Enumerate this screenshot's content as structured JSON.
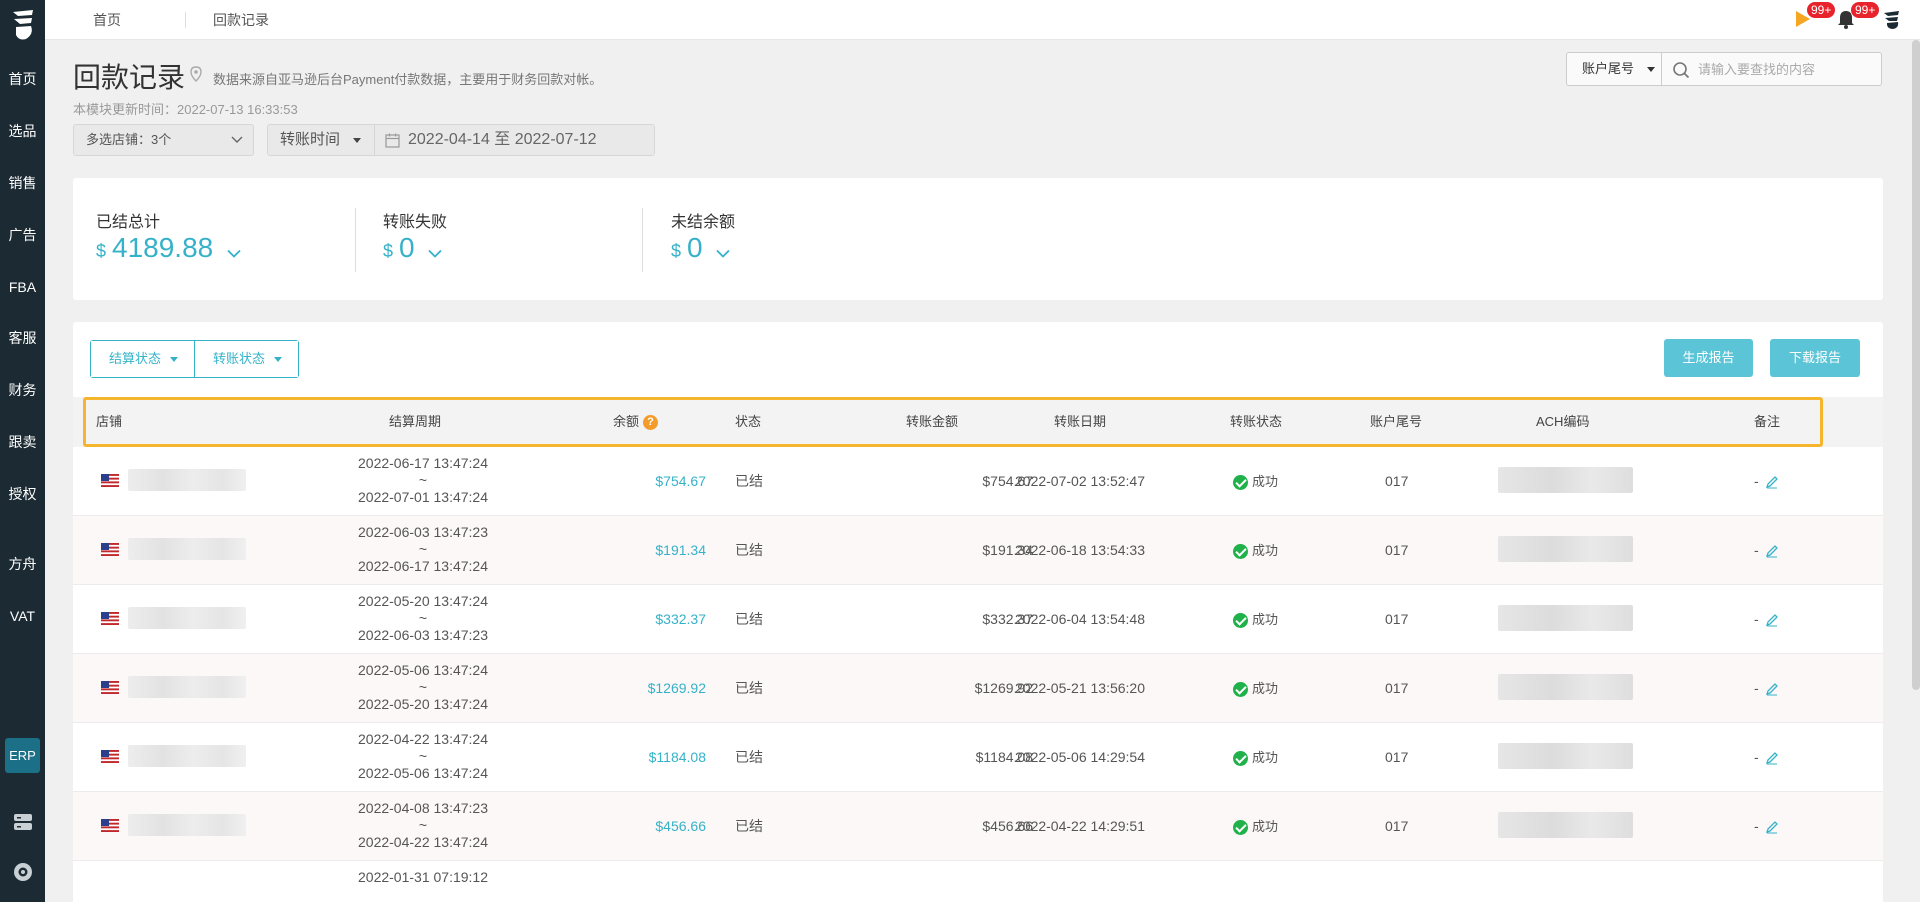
{
  "sidebar": {
    "items": [
      {
        "label": "首页"
      },
      {
        "label": "选品"
      },
      {
        "label": "销售"
      },
      {
        "label": "广告"
      },
      {
        "label": "FBA"
      },
      {
        "label": "客服"
      },
      {
        "label": "财务"
      },
      {
        "label": "跟卖"
      },
      {
        "label": "授权"
      },
      {
        "label": "方舟"
      },
      {
        "label": "VAT"
      }
    ],
    "erp_label": "ERP"
  },
  "topbar": {
    "tabs": [
      "首页",
      "回款记录"
    ],
    "flag_badge": "99+",
    "bell_badge": "99+"
  },
  "header": {
    "title": "回款记录",
    "description": "数据来源自亚马逊后台Payment付款数据，主要用于财务回款对帐。",
    "update_time": "本模块更新时间：2022-07-13 16:33:53",
    "account_select": "账户尾号",
    "search_placeholder": "请输入要查找的内容",
    "store_select": "多选店铺：3个",
    "time_select": "转账时间",
    "date_range": "2022-04-14 至 2022-07-12"
  },
  "summary": {
    "settled": {
      "label": "已结总计",
      "currency": "$",
      "value": "4189.88"
    },
    "failed": {
      "label": "转账失败",
      "currency": "$",
      "value": "0"
    },
    "unsettled": {
      "label": "未结余额",
      "currency": "$",
      "value": "0"
    }
  },
  "table": {
    "filters": [
      "结算状态",
      "转账状态"
    ],
    "buttons": {
      "generate": "生成报告",
      "download": "下载报告"
    },
    "columns": [
      "店铺",
      "结算周期",
      "余额",
      "状态",
      "转账金额",
      "转账日期",
      "转账状态",
      "账户尾号",
      "ACH编码",
      "备注"
    ],
    "help_glyph": "?",
    "rows": [
      {
        "start": "2022-06-17 13:47:24",
        "sep": "~",
        "end": "2022-07-01 13:47:24",
        "balance": "$754.67",
        "status": "已结",
        "amount": "$754.67",
        "date": "2022-07-02 13:52:47",
        "transfer_status": "成功",
        "account": "017",
        "note": "-"
      },
      {
        "start": "2022-06-03 13:47:23",
        "sep": "~",
        "end": "2022-06-17 13:47:24",
        "balance": "$191.34",
        "status": "已结",
        "amount": "$191.34",
        "date": "2022-06-18 13:54:33",
        "transfer_status": "成功",
        "account": "017",
        "note": "-"
      },
      {
        "start": "2022-05-20 13:47:24",
        "sep": "~",
        "end": "2022-06-03 13:47:23",
        "balance": "$332.37",
        "status": "已结",
        "amount": "$332.37",
        "date": "2022-06-04 13:54:48",
        "transfer_status": "成功",
        "account": "017",
        "note": "-"
      },
      {
        "start": "2022-05-06 13:47:24",
        "sep": "~",
        "end": "2022-05-20 13:47:24",
        "balance": "$1269.92",
        "status": "已结",
        "amount": "$1269.92",
        "date": "2022-05-21 13:56:20",
        "transfer_status": "成功",
        "account": "017",
        "note": "-"
      },
      {
        "start": "2022-04-22 13:47:24",
        "sep": "~",
        "end": "2022-05-06 13:47:24",
        "balance": "$1184.08",
        "status": "已结",
        "amount": "$1184.08",
        "date": "2022-05-06 14:29:54",
        "transfer_status": "成功",
        "account": "017",
        "note": "-"
      },
      {
        "start": "2022-04-08 13:47:23",
        "sep": "~",
        "end": "2022-04-22 13:47:24",
        "balance": "$456.66",
        "status": "已结",
        "amount": "$456.66",
        "date": "2022-04-22 14:29:51",
        "transfer_status": "成功",
        "account": "017",
        "note": "-"
      },
      {
        "start": "2022-01-31 07:19:12",
        "sep": "",
        "end": "",
        "balance": "",
        "status": "",
        "amount": "",
        "date": "",
        "transfer_status": "",
        "account": "",
        "note": ""
      }
    ]
  },
  "colors": {
    "accent": "#35b2c9",
    "sidebar": "#1b2a33",
    "success": "#20b14b",
    "highlight": "#f5b52d"
  }
}
